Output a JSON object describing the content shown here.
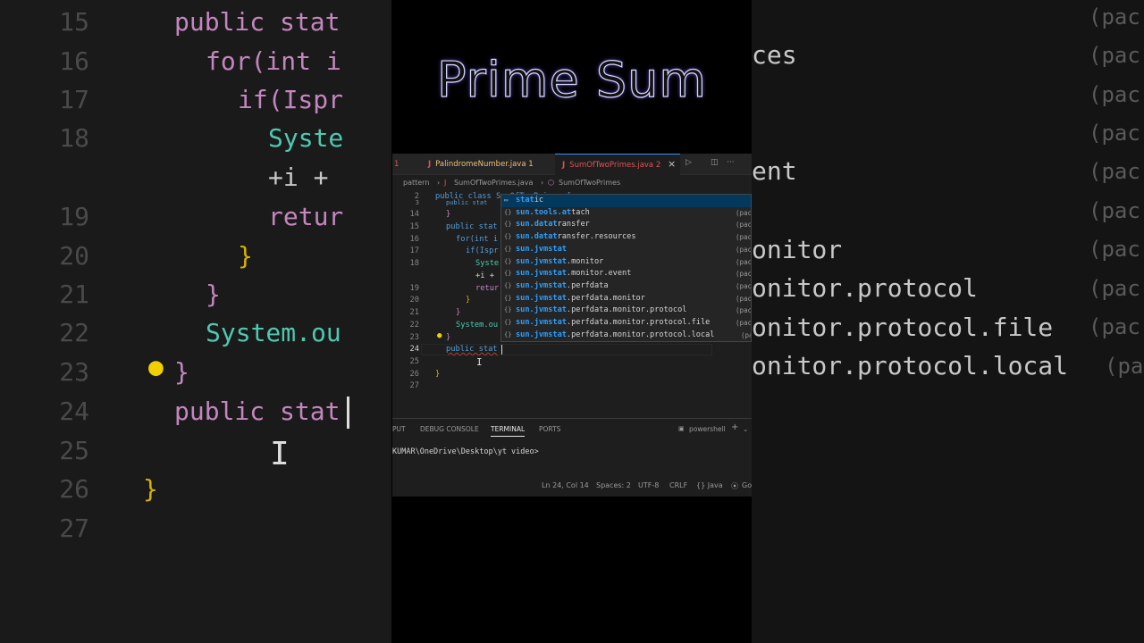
{
  "title": "Prime Sum",
  "tabs": [
    {
      "label": "1",
      "icon": ""
    },
    {
      "label": "PalindromeNumber.java 1",
      "icon": "J"
    },
    {
      "label": "SumOfTwoPrimes.java 2",
      "icon": "J"
    }
  ],
  "tab_close": "×",
  "tab_actions": {
    "run": "▷",
    "split": "◫",
    "more": "···"
  },
  "breadcrumb": {
    "folder": "pattern",
    "file": "SumOfTwoPrimes.java",
    "symbol": "SumOfTwoPrimes"
  },
  "code_lines": [
    {
      "n": "2",
      "text": "public class SumOfTwoPrimes {"
    },
    {
      "n": "3",
      "text": "public stat"
    },
    {
      "n": "14",
      "text": "}"
    },
    {
      "n": "15",
      "text": "public stat"
    },
    {
      "n": "16",
      "text": "for(int i"
    },
    {
      "n": "17",
      "text": "if(Ispr"
    },
    {
      "n": "18",
      "text": "Syste"
    },
    {
      "n": "",
      "text": "+i +"
    },
    {
      "n": "19",
      "text": "retur"
    },
    {
      "n": "20",
      "text": "}"
    },
    {
      "n": "21",
      "text": "}"
    },
    {
      "n": "22",
      "text": "System.ou"
    },
    {
      "n": "23",
      "text": "}"
    },
    {
      "n": "24",
      "text": "public stat"
    },
    {
      "n": "25",
      "text": ""
    },
    {
      "n": "26",
      "text": "}"
    },
    {
      "n": "27",
      "text": ""
    }
  ],
  "suggestions": [
    {
      "match": "stat",
      "rest_before": "",
      "rest": "ic",
      "pac": ""
    },
    {
      "match": "sun.tools.at",
      "rest_before": "",
      "rest": "tach",
      "pac": "(pac"
    },
    {
      "match": "sun.datat",
      "rest_before": "",
      "rest": "ransfer",
      "pac": "(pac"
    },
    {
      "match": "sun.datat",
      "rest_before": "",
      "rest": "ransfer.resources",
      "pac": "(pac"
    },
    {
      "match": "sun.jvmstat",
      "rest_before": "",
      "rest": "",
      "pac": "(pac"
    },
    {
      "match": "sun.jvmstat",
      "rest_before": "",
      "rest": ".monitor",
      "pac": "(pac"
    },
    {
      "match": "sun.jvmstat",
      "rest_before": "",
      "rest": ".monitor.event",
      "pac": "(pac"
    },
    {
      "match": "sun.jvmstat",
      "rest_before": "",
      "rest": ".perfdata",
      "pac": "(pac"
    },
    {
      "match": "sun.jvmstat",
      "rest_before": "",
      "rest": ".perfdata.monitor",
      "pac": "(pac"
    },
    {
      "match": "sun.jvmstat",
      "rest_before": "",
      "rest": ".perfdata.monitor.protocol",
      "pac": "(pac"
    },
    {
      "match": "sun.jvmstat",
      "rest_before": "",
      "rest": ".perfdata.monitor.protocol.file",
      "pac": "(pac"
    },
    {
      "match": "sun.jvmstat",
      "rest_before": "",
      "rest": ".perfdata.monitor.protocol.local",
      "pac": "(pa"
    }
  ],
  "panel_tabs": [
    "PUT",
    "DEBUG CONSOLE",
    "TERMINAL",
    "PORTS"
  ],
  "panel_shell": "powershell",
  "terminal_prompt": "KUMAR\\OneDrive\\Desktop\\yt video>",
  "status": {
    "pos": "Ln 24, Col 14",
    "spaces": "Spaces: 2",
    "enc": "UTF-8",
    "eol": "CRLF",
    "lang": "{} Java",
    "go": "Go"
  },
  "bg_left_lines": [
    {
      "n": "15",
      "text": "public stat"
    },
    {
      "n": "16",
      "text": "for(int i"
    },
    {
      "n": "17",
      "text": "if(Ispr"
    },
    {
      "n": "18",
      "text": "Syste"
    },
    {
      "n": "",
      "text": "+i +"
    },
    {
      "n": "19",
      "text": "retur"
    },
    {
      "n": "20",
      "text": "}"
    },
    {
      "n": "21",
      "text": "}"
    },
    {
      "n": "22",
      "text": "System.ou"
    },
    {
      "n": "23",
      "text": "}"
    },
    {
      "n": "24",
      "text": "public stat"
    },
    {
      "n": "25",
      "text": ""
    },
    {
      "n": "26",
      "text": "}"
    },
    {
      "n": "27",
      "text": ""
    }
  ],
  "bg_right_lines": [
    "ces",
    "",
    "ent",
    "",
    "onitor",
    "onitor.protocol",
    "onitor.protocol.file",
    "onitor.protocol.local"
  ],
  "bg_right_pac": "(pac",
  "colors": {
    "accent": "#3794ff",
    "match": "#2aa0ff",
    "keyword": "#569cd6",
    "type": "#4ec9b0"
  }
}
